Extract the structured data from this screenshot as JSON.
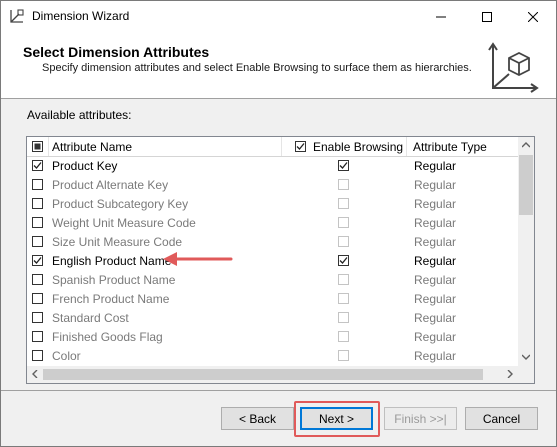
{
  "window": {
    "title": "Dimension Wizard",
    "controls": [
      "minimize",
      "maximize",
      "close"
    ]
  },
  "header": {
    "title": "Select Dimension Attributes",
    "subtitle": "Specify dimension attributes and select Enable Browsing to surface them as hierarchies.",
    "icon": "dimension-cube-icon"
  },
  "available_label": "Available attributes:",
  "grid": {
    "columns": {
      "name": "Attribute Name",
      "browsing": "Enable Browsing",
      "type": "Attribute Type"
    },
    "header_checkbox": "indeterminate",
    "browsing_header_checked": true,
    "rows": [
      {
        "name": "Product Key",
        "checked": true,
        "browsing": true,
        "type": "Regular"
      },
      {
        "name": "Product Alternate Key",
        "checked": false,
        "browsing": false,
        "type": "Regular"
      },
      {
        "name": "Product Subcategory Key",
        "checked": false,
        "browsing": false,
        "type": "Regular"
      },
      {
        "name": "Weight Unit Measure Code",
        "checked": false,
        "browsing": false,
        "type": "Regular"
      },
      {
        "name": "Size Unit Measure Code",
        "checked": false,
        "browsing": false,
        "type": "Regular"
      },
      {
        "name": "English Product Name",
        "checked": true,
        "browsing": true,
        "type": "Regular"
      },
      {
        "name": "Spanish Product Name",
        "checked": false,
        "browsing": false,
        "type": "Regular"
      },
      {
        "name": "French Product Name",
        "checked": false,
        "browsing": false,
        "type": "Regular"
      },
      {
        "name": "Standard Cost",
        "checked": false,
        "browsing": false,
        "type": "Regular"
      },
      {
        "name": "Finished Goods Flag",
        "checked": false,
        "browsing": false,
        "type": "Regular"
      },
      {
        "name": "Color",
        "checked": false,
        "browsing": false,
        "type": "Regular"
      }
    ]
  },
  "buttons": {
    "back": "< Back",
    "next": "Next >",
    "finish": "Finish >>|",
    "cancel": "Cancel"
  },
  "colors": {
    "annotation": "#e05a5a",
    "default_button_border": "#0078d7"
  }
}
